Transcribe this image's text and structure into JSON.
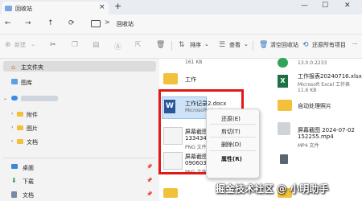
{
  "window": {
    "tab_title": "回收站",
    "tab_close": "×",
    "new_tab": "+",
    "minimize": "—",
    "maximize": "☐",
    "close": "✕"
  },
  "address": {
    "back": "←",
    "forward": "→",
    "up": "↑",
    "refresh": "⟳",
    "separator": ">",
    "location": "回收站"
  },
  "toolbar": {
    "new_label": "新建",
    "sort_label": "排序",
    "view_label": "查看",
    "empty_recycle_label": "清空回收站",
    "restore_all_label": "还原所有项目",
    "more": "···"
  },
  "sidebar": {
    "home_label": "主文件夹",
    "gallery_label": "图库",
    "folders": [
      "附件",
      "图片",
      "文档"
    ],
    "pinned": [
      "桌面",
      "下载",
      "文档"
    ]
  },
  "files": {
    "top_size": "161 KB",
    "work_folder": "工作",
    "docx_name": "工作记录2.docx",
    "docx_type": "Microsoft Word",
    "shot1_name_a": "屏幕截图 2024-07-",
    "shot1_name_b": "133434.png",
    "shot1_type": "PNG 文件",
    "shot2_name_a": "屏幕截图 2024-07",
    "shot2_name_b": "090603.png",
    "shot2_type": "PNG 文件",
    "right_version": "13.0.0.2233",
    "xlsx_name": "工作报表20240716.xlsx",
    "xlsx_type": "Microsoft Excel 工作表",
    "right_size": "11.6 KB",
    "right_partial": "自动处理照片",
    "right_shot_a": "屏幕截图 2024-07-02",
    "right_shot_b": "152255.mp4",
    "right_shot_type": "MP4 文件"
  },
  "context_menu": {
    "restore": "还原(E)",
    "cut": "剪切(T)",
    "delete": "删除(D)",
    "properties": "属性(R)"
  },
  "watermark": "掘金技术社区 @ 小明助手",
  "colors": {
    "highlight_box": "#e11818",
    "folder": "#f2c03a",
    "word_blue": "#2b579a",
    "excel_green": "#1d7044",
    "accent": "#2b6fc2"
  }
}
